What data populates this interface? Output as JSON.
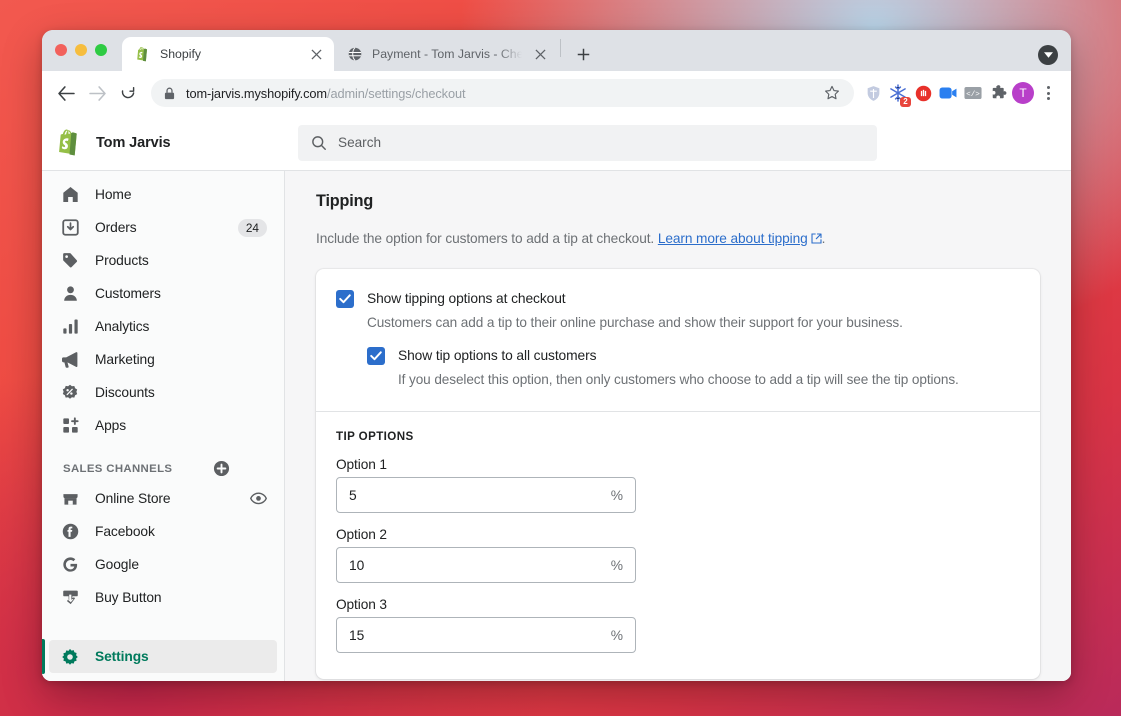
{
  "browser": {
    "tabs": [
      {
        "title": "Shopify",
        "favicon": "shopify-icon",
        "active": true
      },
      {
        "title": "Payment - Tom Jarvis - Checko",
        "favicon": "globe-icon",
        "active": false
      }
    ],
    "new_tab_label": "+",
    "omnibox": {
      "url_host": "tom-jarvis.myshopify.com",
      "url_path": "/admin/settings/checkout",
      "lock_icon": "lock-icon",
      "star_icon": "star-icon"
    },
    "extensions": [
      {
        "name": "shield-icon",
        "badge": ""
      },
      {
        "name": "snowflake-icon",
        "badge": "2"
      },
      {
        "name": "stop-hand-icon",
        "badge": ""
      },
      {
        "name": "video-camera-icon",
        "badge": ""
      },
      {
        "name": "code-brackets-icon",
        "badge": ""
      },
      {
        "name": "puzzle-piece-icon",
        "badge": ""
      }
    ],
    "profile_initial": "T"
  },
  "topbar": {
    "shop_name": "Tom Jarvis",
    "logo": "shopify-logo",
    "search": {
      "placeholder": "Search",
      "value": "",
      "icon": "search-icon"
    }
  },
  "sidebar": {
    "items": [
      {
        "label": "Home",
        "icon": "home-icon",
        "badge": ""
      },
      {
        "label": "Orders",
        "icon": "orders-inbox-icon",
        "badge": "24"
      },
      {
        "label": "Products",
        "icon": "tag-icon",
        "badge": ""
      },
      {
        "label": "Customers",
        "icon": "person-icon",
        "badge": ""
      },
      {
        "label": "Analytics",
        "icon": "bar-chart-icon",
        "badge": ""
      },
      {
        "label": "Marketing",
        "icon": "megaphone-icon",
        "badge": ""
      },
      {
        "label": "Discounts",
        "icon": "discount-badge-icon",
        "badge": ""
      },
      {
        "label": "Apps",
        "icon": "apps-grid-plus-icon",
        "badge": ""
      }
    ],
    "section_title": "SALES CHANNELS",
    "section_add_icon": "plus-circle-icon",
    "channels": [
      {
        "label": "Online Store",
        "icon": "storefront-icon",
        "trailing_icon": "eye-icon"
      },
      {
        "label": "Facebook",
        "icon": "facebook-icon",
        "trailing_icon": ""
      },
      {
        "label": "Google",
        "icon": "google-icon",
        "trailing_icon": ""
      },
      {
        "label": "Buy Button",
        "icon": "buy-button-icon",
        "trailing_icon": ""
      }
    ],
    "settings": {
      "label": "Settings",
      "icon": "gear-icon",
      "selected": true
    }
  },
  "main": {
    "title": "Tipping",
    "description_before": "Include the option for customers to add a tip at checkout.",
    "link_text": "Learn more about tipping",
    "link_icon": "external-link-icon",
    "description_after": ".",
    "checkboxes": [
      {
        "label": "Show tipping options at checkout",
        "help": "Customers can add a tip to their online purchase and show their support for your business.",
        "checked": true
      },
      {
        "label": "Show tip options to all customers",
        "help": "If you deselect this option, then only customers who choose to add a tip will see the tip options.",
        "checked": true
      }
    ],
    "tip_options": {
      "section_label": "TIP OPTIONS",
      "fields": [
        {
          "label": "Option 1",
          "value": "5",
          "suffix": "%"
        },
        {
          "label": "Option 2",
          "value": "10",
          "suffix": "%"
        },
        {
          "label": "Option 3",
          "value": "15",
          "suffix": "%"
        }
      ]
    }
  },
  "colors": {
    "accent_green": "#007a5c",
    "checkbox_blue": "#2c6ecb",
    "link_blue": "#2c6ecb",
    "shopify_green": "#95bf47",
    "badge_red": "#e8453c"
  }
}
